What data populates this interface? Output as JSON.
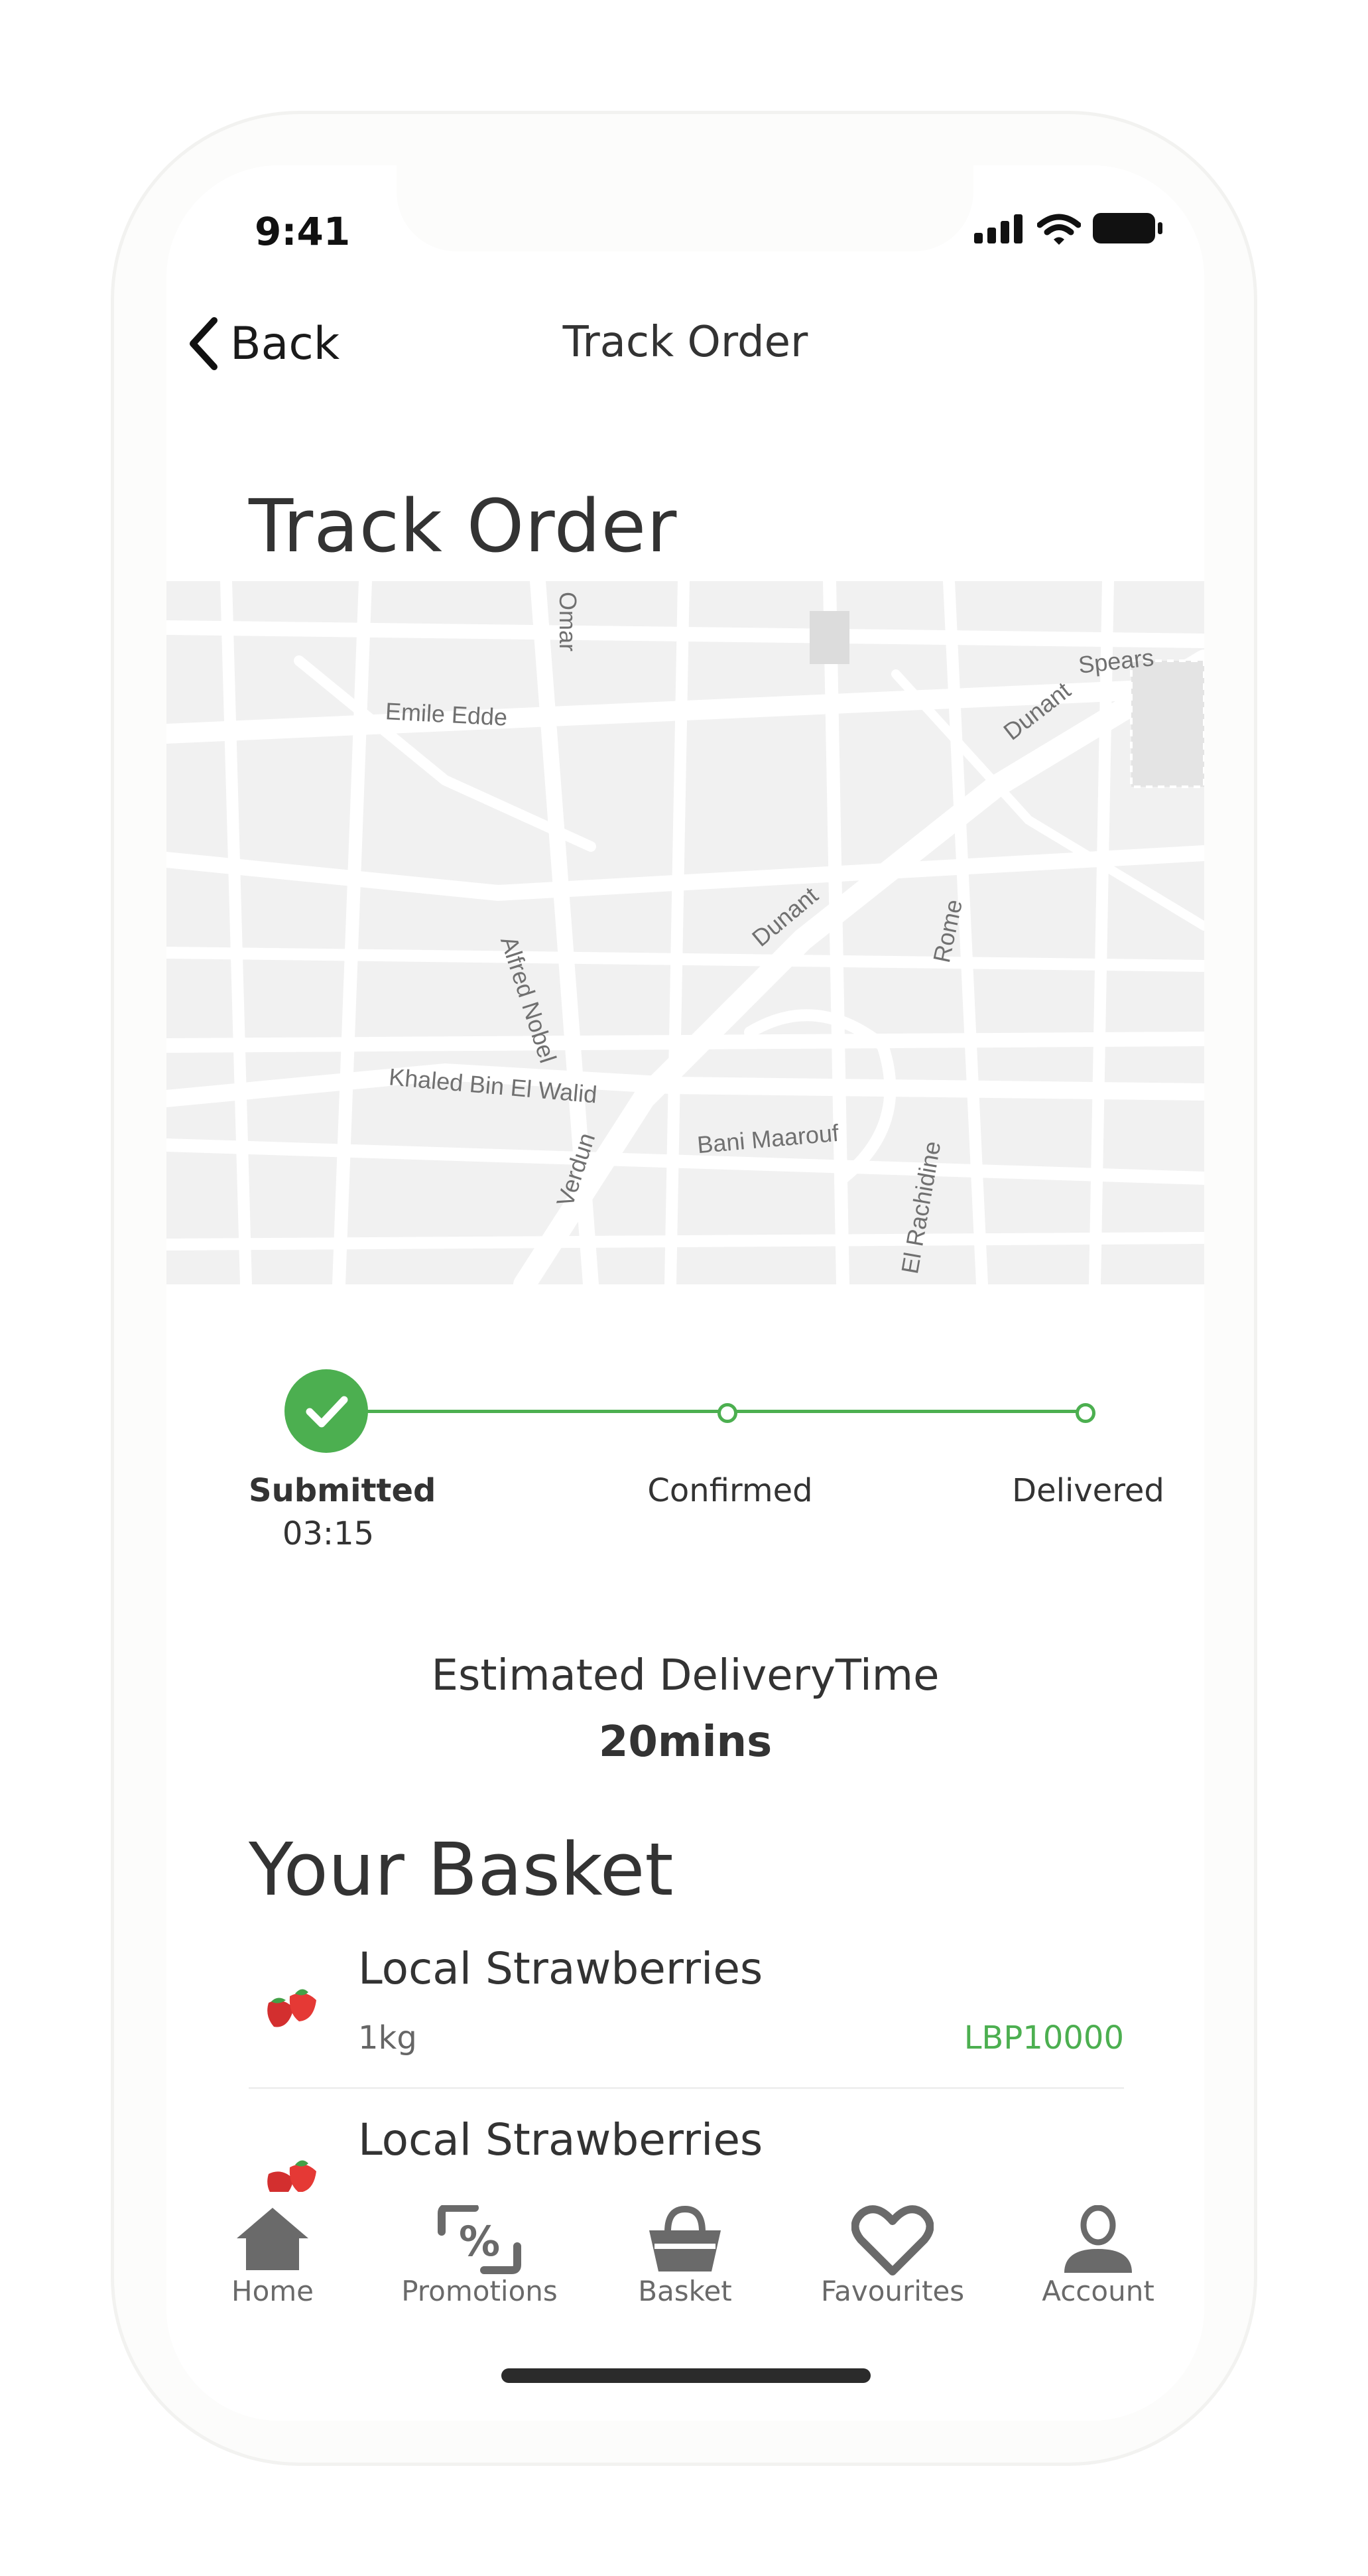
{
  "status_bar": {
    "time": "9:41"
  },
  "nav": {
    "back_label": "Back",
    "title": "Track Order"
  },
  "page": {
    "title": "Track Order"
  },
  "map": {
    "streets": [
      "Omar",
      "Emile Edde",
      "Spears",
      "Dunant",
      "Alfred Nobel",
      "Dunant",
      "Rome",
      "Khaled Bin El Walid",
      "Verdun",
      "Bani Maarouf",
      "El Rachidine"
    ]
  },
  "progress": {
    "steps": [
      {
        "label": "Submitted",
        "time": "03:15",
        "done": true
      },
      {
        "label": "Confirmed",
        "done": false
      },
      {
        "label": "Delivered",
        "done": false
      }
    ],
    "accent_color": "#4caf50"
  },
  "estimate": {
    "label": "Estimated DeliveryTime",
    "value": "20mins"
  },
  "basket": {
    "title": "Your Basket",
    "items": [
      {
        "name": "Local Strawberries",
        "quantity": "1kg",
        "price": "LBP10000",
        "icon": "strawberry-icon"
      },
      {
        "name": "Local Strawberries",
        "quantity": "",
        "price": "",
        "icon": "strawberry-icon"
      }
    ]
  },
  "tabs": [
    {
      "label": "Home",
      "icon": "home-icon"
    },
    {
      "label": "Promotions",
      "icon": "promotions-icon"
    },
    {
      "label": "Basket",
      "icon": "basket-icon"
    },
    {
      "label": "Favourites",
      "icon": "heart-icon"
    },
    {
      "label": "Account",
      "icon": "account-icon"
    }
  ]
}
